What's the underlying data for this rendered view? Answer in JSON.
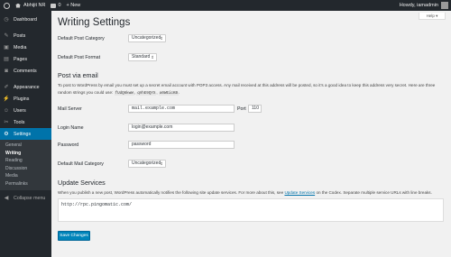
{
  "adminbar": {
    "site_name": "Abhijit NR",
    "comments_count": "0",
    "new_label": "+ New",
    "howdy": "Howdy, iamadmin"
  },
  "sidebar": {
    "items": [
      {
        "label": "Dashboard",
        "icon": "dashboard-icon"
      },
      {
        "label": "Posts",
        "icon": "pin-icon"
      },
      {
        "label": "Media",
        "icon": "media-icon"
      },
      {
        "label": "Pages",
        "icon": "pages-icon"
      },
      {
        "label": "Comments",
        "icon": "comment-icon"
      },
      {
        "label": "Appearance",
        "icon": "brush-icon"
      },
      {
        "label": "Plugins",
        "icon": "plugin-icon"
      },
      {
        "label": "Users",
        "icon": "users-icon"
      },
      {
        "label": "Tools",
        "icon": "wrench-icon"
      },
      {
        "label": "Settings",
        "icon": "settings-icon"
      }
    ],
    "submenu": [
      "General",
      "Writing",
      "Reading",
      "Discussion",
      "Media",
      "Permalinks"
    ],
    "collapse": "Collapse menu"
  },
  "page": {
    "help": "Help ▾",
    "title": "Writing Settings",
    "default_post_category_label": "Default Post Category",
    "default_post_category_value": "Uncategorized",
    "default_post_format_label": "Default Post Format",
    "default_post_format_value": "Standard",
    "post_via_email_heading": "Post via email",
    "post_via_email_text_1": "To post to WordPress by email you must set up a secret email account with POP3 access. Any mail received at this address will be posted, so it’s a good idea to keep this address very secret. Here are three random strings you could use:",
    "random_strings": [
      "fUdQ6kwW",
      "qVhE9QYX",
      "a0WEicKB"
    ],
    "mail_server_label": "Mail Server",
    "mail_server_value": "mail.example.com",
    "port_label": "Port",
    "port_value": "110",
    "login_name_label": "Login Name",
    "login_name_value": "login@example.com",
    "password_label": "Password",
    "password_value": "password",
    "default_mail_category_label": "Default Mail Category",
    "default_mail_category_value": "Uncategorized",
    "update_services_heading": "Update Services",
    "update_services_text_1": "When you publish a new post, WordPress automatically notifies the following site update services. For more about this, see",
    "update_services_link": "Update Services",
    "update_services_text_2": "on the Codex. Separate multiple service URLs with line breaks.",
    "ping_sites": "http://rpc.pingomatic.com/",
    "save_button": "Save Changes"
  },
  "colors": {
    "adminbar_bg": "#23282d",
    "accent": "#0073aa",
    "button": "#0085ba",
    "content_bg": "#f1f1f1"
  }
}
